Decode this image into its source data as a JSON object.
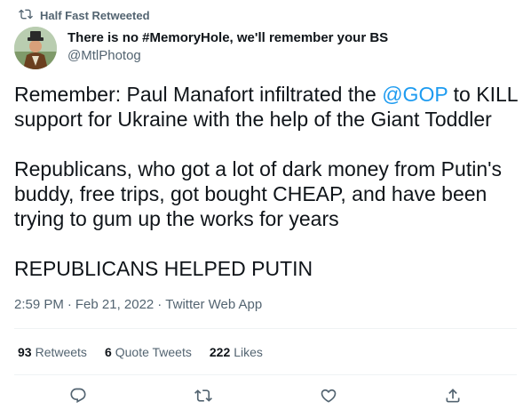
{
  "retweet": {
    "label": "Half Fast Retweeted",
    "icon": "retweet-icon"
  },
  "author": {
    "display_name": "There is no #MemoryHole, we'll remember your BS",
    "handle": "@MtlPhotog"
  },
  "tweet": {
    "p1_before": "Remember: Paul Manafort infiltrated the ",
    "p1_mention": "@GOP",
    "p1_after": " to KILL support for Ukraine with the help of the Giant Toddler",
    "p2": "Republicans, who got a lot of dark money from Putin's buddy, free trips, got bought CHEAP, and have been trying to gum up the works for years",
    "p3": "REPUBLICANS HELPED PUTIN"
  },
  "meta": {
    "time": "2:59 PM",
    "sep1": "·",
    "date": "Feb 21, 2022",
    "sep2": "·",
    "source": "Twitter Web App"
  },
  "stats": [
    {
      "count": "93",
      "label": "Retweets"
    },
    {
      "count": "6",
      "label": "Quote Tweets"
    },
    {
      "count": "222",
      "label": "Likes"
    }
  ],
  "actions": {
    "reply_icon": "reply-icon",
    "retweet_icon": "retweet-icon",
    "like_icon": "heart-icon",
    "share_icon": "share-icon"
  },
  "colors": {
    "text": "#0f1419",
    "secondary": "#536471",
    "accent": "#1d9bf0",
    "divider": "#eff3f4"
  }
}
